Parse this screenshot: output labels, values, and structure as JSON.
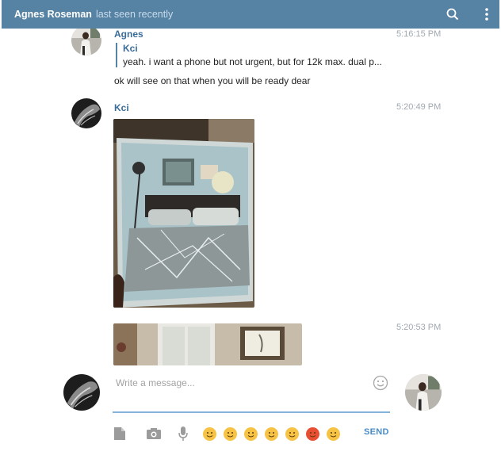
{
  "header": {
    "peer_name": "Agnes Roseman",
    "peer_status": "last seen recently"
  },
  "messages": [
    {
      "sender": "Agnes",
      "time": "5:16:15 PM",
      "reply": {
        "sender": "Kci",
        "text": "yeah. i want a phone but not urgent, but for 12k max. dual p..."
      },
      "text": "ok will see on that when you will be ready dear"
    },
    {
      "sender": "Kci",
      "time": "5:20:49 PM",
      "type": "photo"
    },
    {
      "time": "5:20:53 PM",
      "type": "photo"
    }
  ],
  "composer": {
    "placeholder": "Write a message...",
    "send_label": "SEND"
  },
  "icons": {
    "search": "search-icon",
    "more": "more-vertical-icon",
    "attach": "document-icon",
    "photo": "camera-icon",
    "voice": "microphone-icon",
    "emoji_toggle": "smile-icon"
  }
}
